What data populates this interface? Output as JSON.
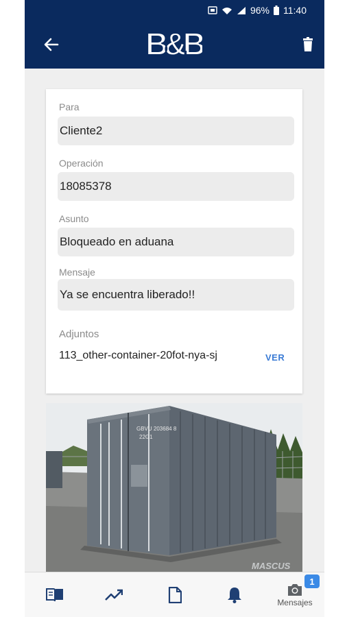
{
  "status_bar": {
    "battery": "96%",
    "time": "11:40"
  },
  "header": {
    "logo_text": "B&B"
  },
  "form": {
    "para_label": "Para",
    "para_value": "Cliente2",
    "operacion_label": "Operación",
    "operacion_value": "18085378",
    "asunto_label": "Asunto",
    "asunto_value": "Bloqueado en aduana",
    "mensaje_label": "Mensaje",
    "mensaje_value": "Ya se encuentra liberado!!",
    "adjuntos_label": "Adjuntos",
    "adjunto_filename": "113_other-container-20fot-nya-sj",
    "ver_label": "VER"
  },
  "photo": {
    "container_marking_1": "GBVU 203684 8",
    "container_marking_2": "22G1",
    "watermark": "MASCUS"
  },
  "bottom_nav": {
    "items": [
      {
        "icon": "book-icon"
      },
      {
        "icon": "trending-up-icon"
      },
      {
        "icon": "document-icon"
      },
      {
        "icon": "bell-icon"
      },
      {
        "icon": "camera-icon",
        "label": "Mensajes"
      }
    ],
    "badge_count": "1"
  },
  "colors": {
    "header_bg": "#0a2a5e",
    "accent": "#3a7bd5",
    "badge": "#3b8ae6"
  }
}
